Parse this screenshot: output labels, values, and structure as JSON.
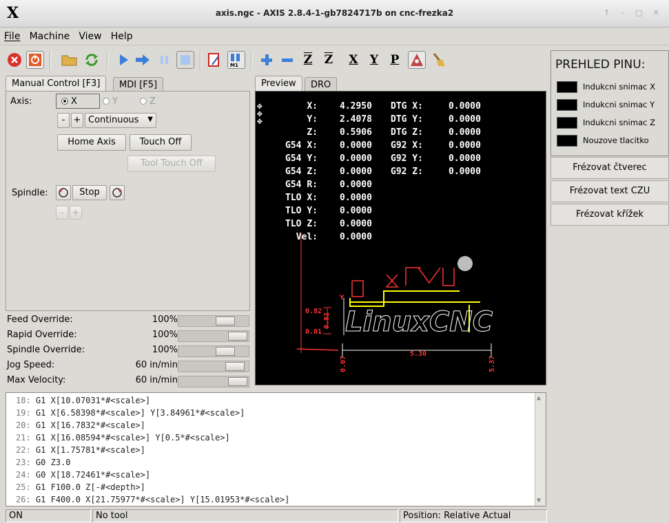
{
  "window": {
    "logo": "X",
    "title": "axis.ngc - AXIS 2.8.4-1-gb7824717b on cnc-frezka2",
    "controls": "↑ – □ ✕"
  },
  "menu": [
    {
      "label": "File"
    },
    {
      "label": "Machine"
    },
    {
      "label": "View"
    },
    {
      "label": "Help"
    }
  ],
  "toolbar": {
    "icons": [
      "estop-icon",
      "machine-power-icon",
      "open-file-icon",
      "reload-icon",
      "run-icon",
      "step-icon",
      "pause-icon",
      "stop-icon",
      "block-delete-icon",
      "optional-stop-icon",
      "zoom-in-icon",
      "zoom-out-icon",
      "view-z-icon",
      "view-z2-icon",
      "view-x-icon",
      "view-y-icon",
      "view-p-icon",
      "rotate-view-icon",
      "clear-plot-icon"
    ],
    "view_labels": {
      "z": "Z",
      "z2": "Z",
      "x": "X",
      "y": "Y",
      "p": "P"
    }
  },
  "left_tabs": [
    {
      "label": "Manual Control [F3]",
      "active": true
    },
    {
      "label": "MDI [F5]",
      "active": false
    }
  ],
  "manual": {
    "axis_label": "Axis:",
    "axes": [
      {
        "label": "X",
        "selected": true
      },
      {
        "label": "Y",
        "selected": false
      },
      {
        "label": "Z",
        "selected": false
      }
    ],
    "minus": "-",
    "plus": "+",
    "jog_mode": "Continuous",
    "home_axis": "Home Axis",
    "touch_off": "Touch Off",
    "tool_touch_off": "Tool Touch Off",
    "spindle_label": "Spindle:",
    "spindle_stop": "Stop"
  },
  "overrides": [
    {
      "label": "Feed Override:",
      "value": "100%",
      "fraction": 0.75
    },
    {
      "label": "Rapid Override:",
      "value": "100%",
      "fraction": 1.0
    },
    {
      "label": "Spindle Override:",
      "value": "100%",
      "fraction": 0.75
    },
    {
      "label": "Jog Speed:",
      "value": "60 in/min",
      "fraction": 0.95
    },
    {
      "label": "Max Velocity:",
      "value": "60 in/min",
      "fraction": 1.0
    }
  ],
  "preview_tabs": [
    {
      "label": "Preview",
      "active": true
    },
    {
      "label": "DRO",
      "active": false
    }
  ],
  "dro": [
    {
      "label": "X:",
      "value": "4.2950",
      "label2": "DTG X:",
      "value2": "0.0000"
    },
    {
      "label": "Y:",
      "value": "2.4078",
      "label2": "DTG Y:",
      "value2": "0.0000"
    },
    {
      "label": "Z:",
      "value": "0.5906",
      "label2": "DTG Z:",
      "value2": "0.0000"
    },
    {
      "label": "G54 X:",
      "value": "0.0000",
      "label2": "G92 X:",
      "value2": "0.0000"
    },
    {
      "label": "G54 Y:",
      "value": "0.0000",
      "label2": "G92 Y:",
      "value2": "0.0000"
    },
    {
      "label": "G54 Z:",
      "value": "0.0000",
      "label2": "G92 Z:",
      "value2": "0.0000"
    },
    {
      "label": "G54 R:",
      "value": "0.0000"
    },
    {
      "label": "TLO X:",
      "value": "0.0000"
    },
    {
      "label": "TLO Y:",
      "value": "0.0000"
    },
    {
      "label": "TLO Z:",
      "value": "0.0000"
    },
    {
      "label": "Vel:",
      "value": "0.0000"
    }
  ],
  "preview_plot": {
    "logo_text": "LinuxCNC",
    "dim_labels": {
      "y_top": "0.82",
      "y_top_rot": "0.82",
      "y_bottom": "0.01",
      "x_width": "5.30",
      "x_left": "0.07",
      "x_right": "5.37",
      "y_axis": "Y"
    },
    "colors": {
      "path": "#ffff00",
      "rapid": "#ff3333",
      "dims": "#ff3333"
    }
  },
  "pins": {
    "header": "PREHLED PINU:",
    "items": [
      {
        "label": "Indukcni snimac X"
      },
      {
        "label": "Indukcni snimac Y"
      },
      {
        "label": "Indukcni snimac Z"
      },
      {
        "label": "Nouzove tlacitko"
      }
    ]
  },
  "right_buttons": [
    {
      "label": "Frézovat čtverec"
    },
    {
      "label": "Frézovat text CZU"
    },
    {
      "label": "Frézovat křížek"
    }
  ],
  "code": [
    {
      "n": "18:",
      "text": "G1 X[10.07031*#<scale>]"
    },
    {
      "n": "19:",
      "text": "G1 X[6.58398*#<scale>] Y[3.84961*#<scale>]"
    },
    {
      "n": "20:",
      "text": "G1 X[16.7832*#<scale>]"
    },
    {
      "n": "21:",
      "text": "G1 X[16.08594*#<scale>] Y[0.5*#<scale>]"
    },
    {
      "n": "22:",
      "text": "G1 X[1.75781*#<scale>]"
    },
    {
      "n": "23:",
      "text": "G0 Z3.0"
    },
    {
      "n": "24:",
      "text": "G0 X[18.72461*#<scale>]"
    },
    {
      "n": "25:",
      "text": "G1 F100.0 Z[-#<depth>]"
    },
    {
      "n": "26:",
      "text": "G1 F400.0 X[21.75977*#<scale>] Y[15.01953*#<scale>]"
    }
  ],
  "status": {
    "state": "ON",
    "tool": "No tool",
    "position": "Position: Relative Actual"
  }
}
